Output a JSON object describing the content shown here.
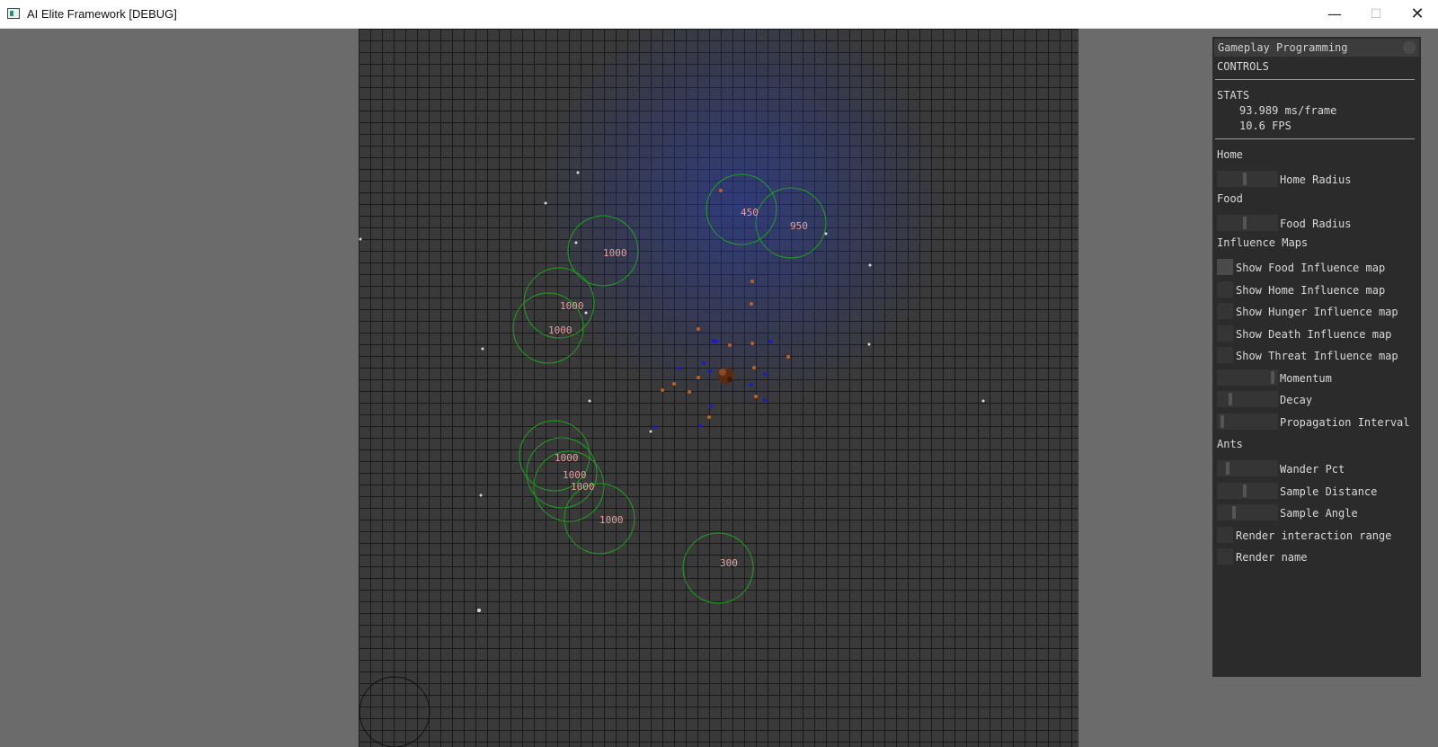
{
  "window": {
    "title": "AI Elite Framework [DEBUG]",
    "minimize_glyph": "—",
    "maximize_glyph": "☐",
    "close_glyph": "✕"
  },
  "world": {
    "areas": [
      {
        "value": "450"
      },
      {
        "value": "950"
      },
      {
        "value": "1000"
      },
      {
        "value": "1000"
      },
      {
        "value": "1000"
      },
      {
        "value": "1000"
      },
      {
        "value": "1000"
      },
      {
        "value": "1000"
      },
      {
        "value": "1000"
      },
      {
        "value": "300"
      }
    ]
  },
  "panel": {
    "title": "Gameplay Programming",
    "controls_header": "CONTROLS",
    "stats_header": "STATS",
    "ms_per_frame": "93.989 ms/frame",
    "fps": "10.6 FPS",
    "home_header": "Home",
    "home_radius_label": "Home Radius",
    "home_radius_level": 0.45,
    "food_header": "Food",
    "food_radius_label": "Food Radius",
    "food_radius_level": 0.45,
    "influence_header": "Influence Maps",
    "show_food": "Show Food Influence map",
    "show_home": "Show Home Influence map",
    "show_hunger": "Show Hunger Influence map",
    "show_death": "Show Death Influence map",
    "show_threat": "Show Threat Influence map",
    "momentum_label": "Momentum",
    "momentum_level": 0.95,
    "decay_label": "Decay",
    "decay_level": 0.2,
    "propagation_label": "Propagation Interval",
    "propagation_level": 0.05,
    "ants_header": "Ants",
    "wander_label": "Wander Pct",
    "wander_level": 0.15,
    "sample_distance_label": "Sample Distance",
    "sample_distance_level": 0.45,
    "sample_angle_label": "Sample Angle",
    "sample_angle_level": 0.25,
    "render_range_label": "Render interaction range",
    "render_name_label": "Render name"
  }
}
